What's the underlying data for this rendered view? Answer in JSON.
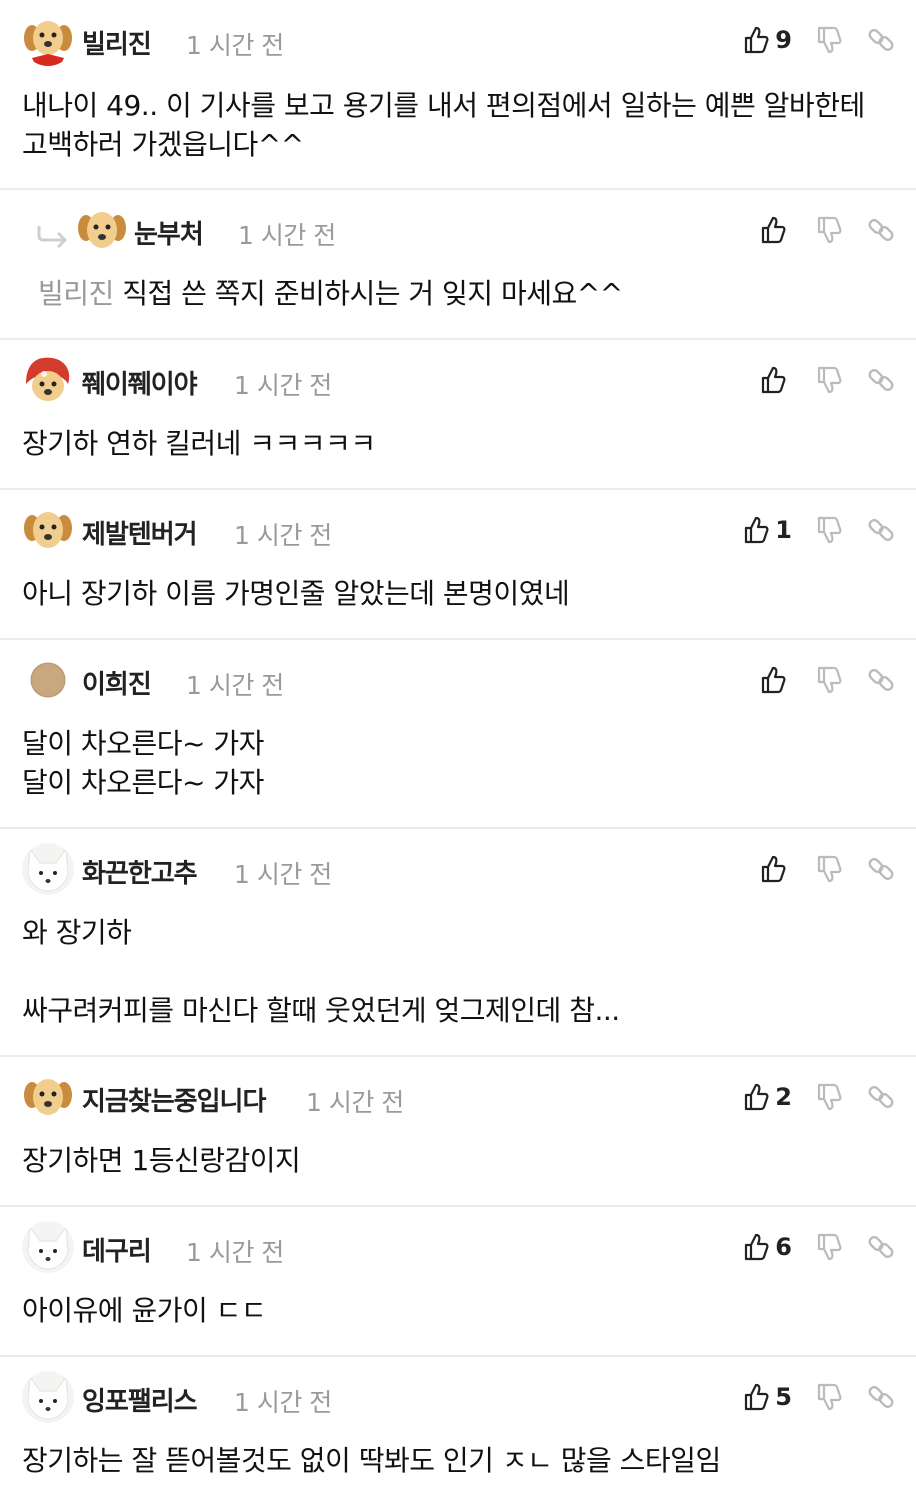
{
  "time_label": "1 시간 전",
  "comments": [
    {
      "nick": "빌리진",
      "avatar": "puppy-red-bandana",
      "likes": "9",
      "text": "내나이 49.. 이 기사를 보고 용기를 내서 편의점에서 일하는 예쁜 알바한테 고백하러 가겠읍니다^^"
    },
    {
      "nick": "눈부처",
      "avatar": "puppy",
      "likes": "",
      "mention": "빌리진",
      "text": "직접 쓴 쪽지 준비하시는 거 잊지 마세요^^"
    },
    {
      "nick": "쮀이쮀이야",
      "avatar": "puppy-red-hood",
      "likes": "",
      "text": "장기하 연하 킬러네 ㅋㅋㅋㅋㅋ"
    },
    {
      "nick": "제발텐버거",
      "avatar": "puppy",
      "likes": "1",
      "text": "아니 장기하 이름 가명인줄 알았는데 본명이였네"
    },
    {
      "nick": "이희진",
      "avatar": "default-circle",
      "likes": "",
      "text": "달이 차오른다~ 가자\n달이 차오른다~ 가자"
    },
    {
      "nick": "화끈한고추",
      "avatar": "white-fox",
      "likes": "",
      "text": "와 장기하\n\n싸구려커피를 마신다 할때 웃었던게 엊그제인데 참..."
    },
    {
      "nick": "지금찾는중입니다",
      "avatar": "puppy",
      "likes": "2",
      "text": "장기하면 1등신랑감이지"
    },
    {
      "nick": "데구리",
      "avatar": "white-fox",
      "likes": "6",
      "text": "아이유에 윤가이 ㄷㄷ"
    },
    {
      "nick": "잉포팰리스",
      "avatar": "white-fox",
      "likes": "5",
      "text": "장기하는 잘 뜯어볼것도 없이 딱봐도 인기 ㅈㄴ 많을 스타일임"
    }
  ],
  "icons": {
    "like": "thumbs-up-icon",
    "dislike": "thumbs-down-icon",
    "link": "link-icon",
    "reply": "reply-arrow-icon"
  },
  "colors": {
    "text": "#111111",
    "muted": "#9a9a9a",
    "divider": "#ececec"
  }
}
